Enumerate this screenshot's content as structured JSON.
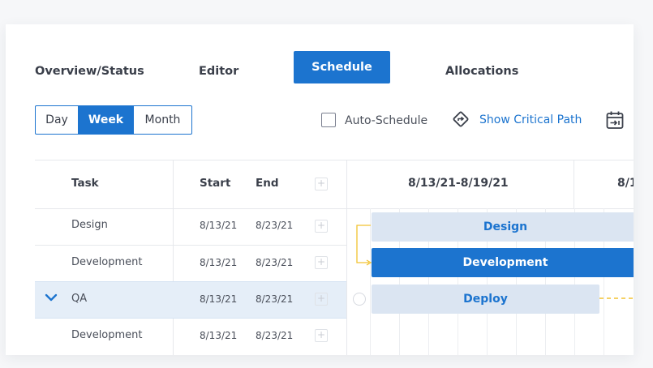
{
  "tabs": [
    {
      "label": "Overview/Status"
    },
    {
      "label": "Editor"
    },
    {
      "label": "Schedule",
      "active": true
    },
    {
      "label": "Allocations"
    }
  ],
  "view_toggle": {
    "options": [
      "Day",
      "Week",
      "Month"
    ],
    "selected": "Week"
  },
  "toolbar": {
    "auto_schedule_label": "Auto-Schedule",
    "auto_schedule_checked": false,
    "critical_path_label": "Show Critical Path",
    "critical_path_icon": "route-diamond-icon",
    "calendar_icon": "calendar-arrow-icon"
  },
  "table": {
    "columns": [
      "Task",
      "Start",
      "End"
    ],
    "rows": [
      {
        "task": "Design",
        "start": "8/13/21",
        "end": "8/23/21"
      },
      {
        "task": "Development",
        "start": "8/13/21",
        "end": "8/23/21"
      },
      {
        "task": "QA",
        "start": "8/13/21",
        "end": "8/23/21",
        "expanded": true,
        "highlighted": true
      },
      {
        "task": "Development",
        "start": "8/13/21",
        "end": "8/23/21"
      }
    ]
  },
  "gantt": {
    "periods": [
      "8/13/21-8/19/21",
      "8/1"
    ],
    "bars": [
      {
        "label": "Design",
        "style": "light"
      },
      {
        "label": "Development",
        "style": "dark"
      },
      {
        "label": "Deploy",
        "style": "light"
      }
    ]
  },
  "colors": {
    "accent": "#1c74cf",
    "bar_light": "#dbe5f2",
    "highlight_row": "#e5eef8",
    "dependency": "#f2c230"
  }
}
